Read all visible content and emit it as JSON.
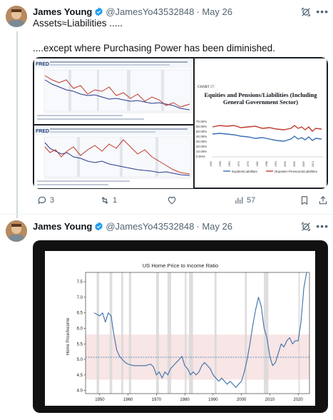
{
  "tweet1": {
    "name": "James Young",
    "handle": "@JamesYo43532848",
    "date": "· May 26",
    "line1": "Assets≈Liabilities .....",
    "line2": "....except where Purchasing Power has been diminished.",
    "chart_label_fred": "FRED",
    "chart17_label": "CHART 17:",
    "chart17_title": "Equities and Pensions/Liabilities (Including General Government Sector)",
    "chart17_legend": [
      "Equities/Liabilities",
      "(Equities+Pensions)/Liabilities"
    ],
    "chart17_colors": [
      "#3a6fb5",
      "#c0392b"
    ],
    "fred_colors": [
      "#2a3a8a",
      "#c0392b"
    ],
    "replies": "3",
    "reposts": "1",
    "views": "57"
  },
  "tweet2": {
    "name": "James Young",
    "handle": "@JamesYo43532848",
    "date": "· May 26"
  },
  "chart_data": {
    "type": "line",
    "title": "US Home Price to Income Ratio",
    "xlabel": "",
    "ylabel": "Home Price/Income",
    "xlim": [
      1945,
      2024
    ],
    "ylim": [
      3.9,
      7.8
    ],
    "xticks": [
      "1950",
      "1960",
      "1970",
      "1980",
      "1990",
      "2000",
      "2010",
      "2020"
    ],
    "yticks": [
      "4.0",
      "4.5",
      "5.0",
      "5.5",
      "6.0",
      "6.5",
      "7.0",
      "7.5"
    ],
    "mean_line": 5.07,
    "band": [
      4.35,
      5.8
    ],
    "recessions": [
      [
        1948.9,
        1949.8
      ],
      [
        1953.5,
        1954.4
      ],
      [
        1957.6,
        1958.3
      ],
      [
        1960.3,
        1961.1
      ],
      [
        1969.9,
        1970.9
      ],
      [
        1973.9,
        1975.2
      ],
      [
        1980.0,
        1980.6
      ],
      [
        1981.5,
        1982.9
      ],
      [
        1990.5,
        1991.2
      ],
      [
        2001.2,
        2001.9
      ],
      [
        2007.9,
        2009.5
      ],
      [
        2020.1,
        2020.4
      ]
    ],
    "series": [
      {
        "color": "#3b6fa8",
        "x": [
          1948,
          1950,
          1951,
          1952,
          1953,
          1954,
          1955,
          1956,
          1957,
          1958,
          1959,
          1960,
          1962,
          1964,
          1966,
          1968,
          1969,
          1970,
          1971,
          1972,
          1973,
          1974,
          1975,
          1976,
          1977,
          1978,
          1979,
          1980,
          1981,
          1982,
          1983,
          1984,
          1985,
          1986,
          1987,
          1988,
          1989,
          1990,
          1991,
          1992,
          1993,
          1994,
          1995,
          1996,
          1997,
          1998,
          1999,
          2000,
          2001,
          2002,
          2003,
          2004,
          2005,
          2006,
          2007,
          2008,
          2009,
          2010,
          2011,
          2012,
          2013,
          2014,
          2015,
          2016,
          2017,
          2018,
          2019,
          2020,
          2021,
          2022,
          2023
        ],
        "y": [
          6.5,
          6.4,
          6.5,
          6.2,
          6.5,
          6.4,
          5.8,
          5.3,
          5.1,
          5.0,
          4.9,
          4.85,
          4.8,
          4.8,
          4.8,
          4.85,
          4.75,
          4.5,
          4.6,
          4.4,
          4.6,
          4.5,
          4.7,
          4.8,
          4.9,
          5.0,
          5.1,
          4.8,
          4.7,
          4.5,
          4.6,
          4.5,
          4.6,
          4.8,
          4.9,
          4.8,
          4.7,
          4.5,
          4.4,
          4.3,
          4.4,
          4.3,
          4.2,
          4.3,
          4.2,
          4.1,
          4.2,
          4.3,
          4.6,
          5.0,
          5.5,
          6.1,
          6.6,
          7.0,
          6.7,
          6.0,
          5.7,
          5.1,
          4.8,
          4.9,
          5.2,
          5.5,
          5.4,
          5.6,
          5.7,
          5.5,
          5.6,
          5.6,
          6.2,
          7.3,
          7.8
        ]
      }
    ]
  }
}
